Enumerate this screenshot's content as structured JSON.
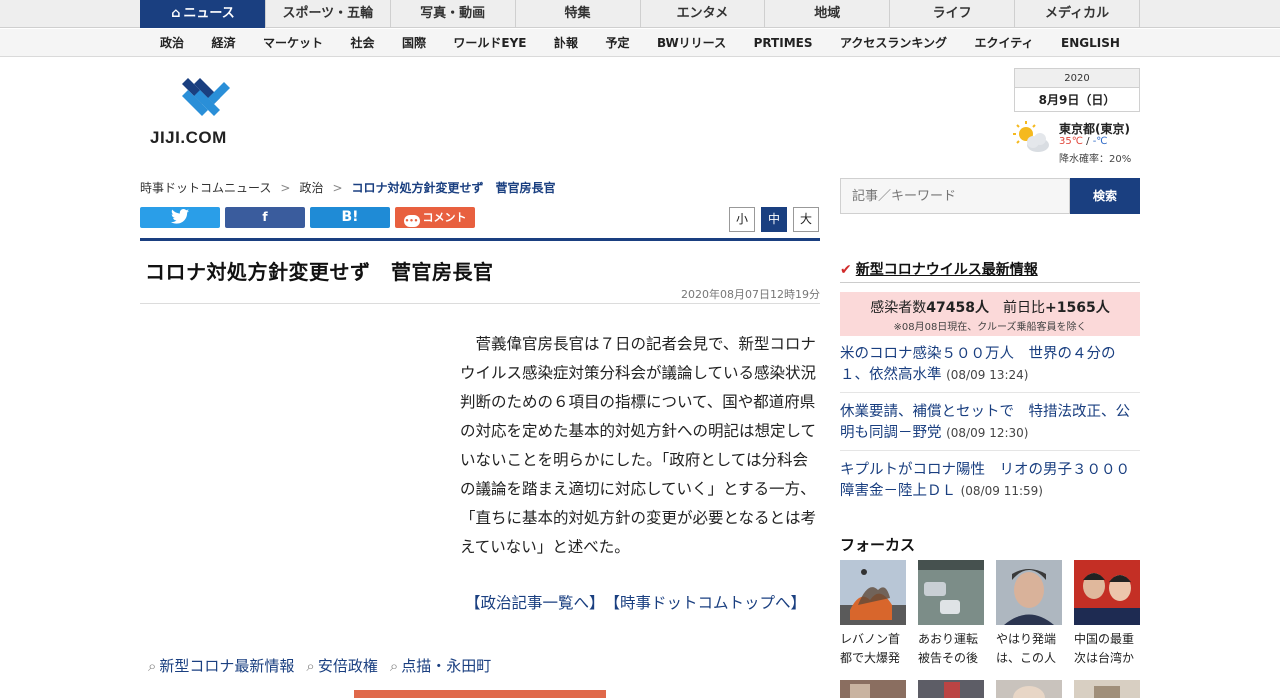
{
  "top_nav": [
    {
      "label": "ニュース",
      "active": true
    },
    {
      "label": "スポーツ・五輪",
      "active": false
    },
    {
      "label": "写真・動画",
      "active": false
    },
    {
      "label": "特集",
      "active": false
    },
    {
      "label": "エンタメ",
      "active": false
    },
    {
      "label": "地域",
      "active": false
    },
    {
      "label": "ライフ",
      "active": false
    },
    {
      "label": "メディカル",
      "active": false
    }
  ],
  "sub_nav": [
    "政治",
    "経済",
    "マーケット",
    "社会",
    "国際",
    "ワールドEYE",
    "訃報",
    "予定",
    "BWリリース",
    "PRTIMES",
    "アクセスランキング",
    "エクイティ",
    "ENGLISH"
  ],
  "logo_text": "JIJI.COM",
  "date": {
    "year": "2020",
    "day": "8月9日（日）"
  },
  "weather": {
    "city": "東京都(東京)",
    "high": "35℃",
    "sep": " / ",
    "low": "-℃",
    "rain": "降水確率：20%"
  },
  "breadcrumb": {
    "home": "時事ドットコムニュース",
    "section": "政治",
    "current": "コロナ対処方針変更せず　菅官房長官",
    "sep": ">"
  },
  "share": {
    "twitter": "twitter",
    "facebook": "f",
    "hatena": "B!",
    "comment": "コメント"
  },
  "font_size": {
    "small": "小",
    "medium": "中",
    "large": "大"
  },
  "article": {
    "title": "コロナ対処方針変更せず　菅官房長官",
    "datetime": "2020年08月07日12時19分",
    "body": "菅義偉官房長官は７日の記者会見で、新型コロナウイルス感染症対策分科会が議論している感染状況判断のための６項目の指標について、国や都道府県の対応を定めた基本的対処方針への明記は想定していないことを明らかにした。「政府としては分科会の議論を踏まえ適切に対応していく」とする一方、「直ちに基本的対処方針の変更が必要となるとは考えていない」と述べた。",
    "link1": "【政治記事一覧へ】",
    "link2": "【時事ドットコムトップへ】",
    "tags": [
      "新型コロナ最新情報",
      "安倍政権",
      "点描・永田町"
    ]
  },
  "search": {
    "placeholder": "記事／キーワード",
    "button": "検索"
  },
  "corona": {
    "title": "新型コロナウイルス最新情報",
    "infect_label": "感染者数",
    "infect_count": "47458人",
    "diff_label": "前日比",
    "diff_count": "+1565人",
    "note": "※08月08日現在、クルーズ乗船客員を除く",
    "news": [
      {
        "text": "米のコロナ感染５００万人　世界の４分の１、依然高水準",
        "time": "(08/09 13:24)"
      },
      {
        "text": "休業要請、補償とセットで　特措法改正、公明も同調－野党",
        "time": "(08/09 12:30)"
      },
      {
        "text": "キプルトがコロナ陽性　リオの男子３０００障害金－陸上ＤＬ",
        "time": "(08/09 11:59)"
      }
    ]
  },
  "focus": {
    "title": "フォーカス",
    "items": [
      {
        "caption": "レバノン首都で大爆発"
      },
      {
        "caption": "あおり運転被告その後"
      },
      {
        "caption": "やはり発端は、この人"
      },
      {
        "caption": "中国の最重次は台湾か"
      }
    ]
  },
  "colors": {
    "brand": "#1a3f80",
    "infect_bg": "#fbd9d9",
    "comment": "#e8603f"
  }
}
